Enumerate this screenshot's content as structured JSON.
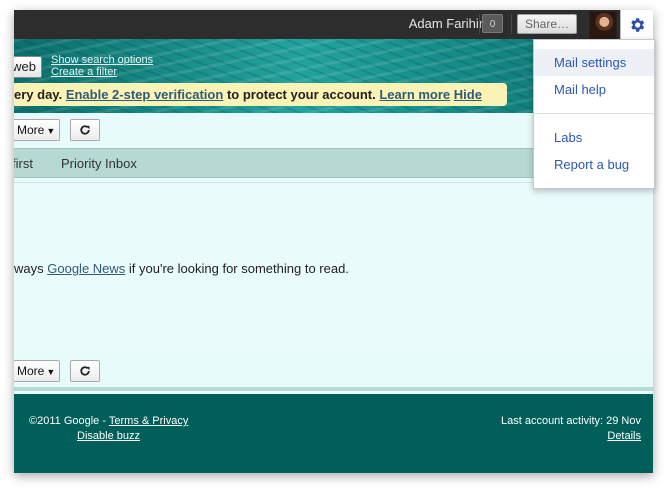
{
  "topbar": {
    "user_name": "Adam Farihin",
    "notification_count": "0",
    "share_label": "Share…",
    "settings_icon": "gear-icon"
  },
  "search": {
    "web_button_label": "web",
    "show_options_label": "Show search options",
    "create_filter_label": "Create a filter"
  },
  "promo": {
    "text_start": "ery day.",
    "enable_link": "Enable 2-step verification",
    "text_middle": "to protect your account.",
    "learn_more": "Learn more",
    "hide": "Hide"
  },
  "toolbar": {
    "more_label": "More",
    "refresh_icon": "refresh-icon"
  },
  "tabs": {
    "unread_first": "first",
    "priority_inbox": "Priority Inbox"
  },
  "main": {
    "message_start": "ways",
    "google_news": "Google News",
    "message_end": "if you're looking for something to read."
  },
  "footer": {
    "copyright": "©2011 Google -",
    "terms": "Terms & Privacy",
    "disable_buzz": "Disable buzz",
    "last_activity": "Last account activity: 29 Nov",
    "details": "Details"
  },
  "menu": {
    "items": [
      {
        "label": "Mail settings"
      },
      {
        "label": "Mail help"
      },
      {
        "label": "Labs"
      },
      {
        "label": "Report a bug"
      }
    ]
  },
  "colors": {
    "topbar": "#2d2d2d",
    "banner": "#1a8f8a",
    "footer": "#005f58",
    "promo": "#faf3b5",
    "menu_link": "#2a58b2"
  }
}
